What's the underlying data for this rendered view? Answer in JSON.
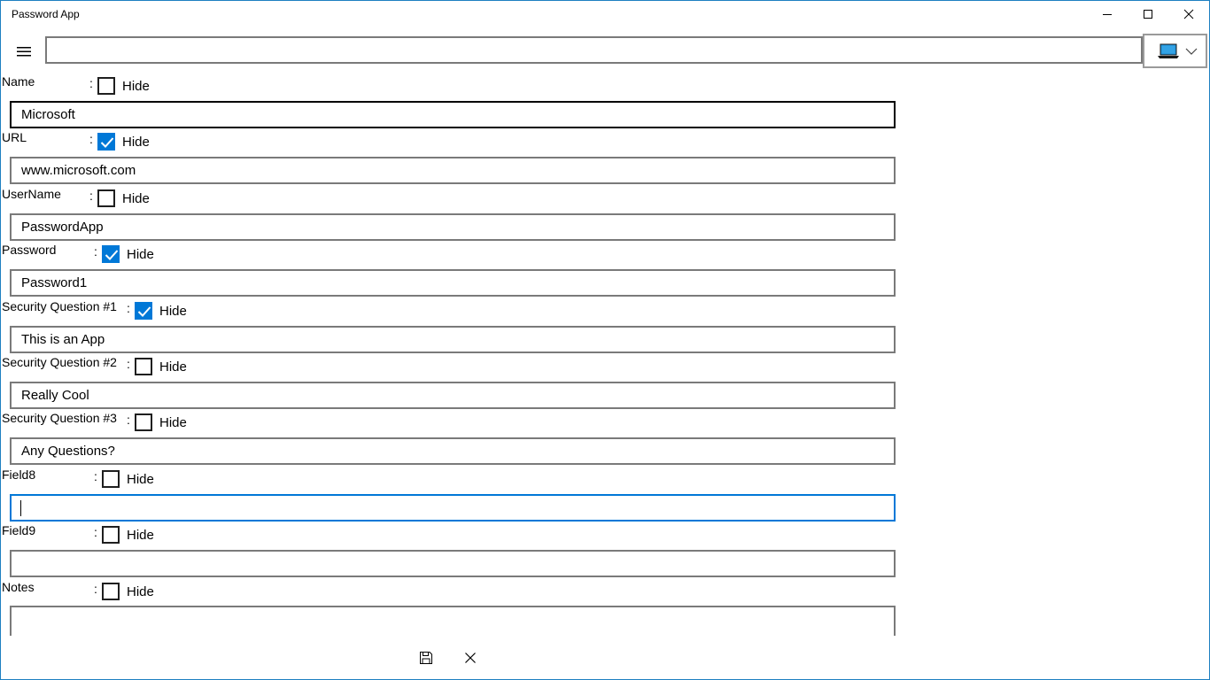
{
  "window": {
    "title": "Password App"
  },
  "toolbar": {
    "search_value": ""
  },
  "fields": [
    {
      "label": "Name",
      "hide_label": "Hide",
      "hidden": false,
      "value": "Microsoft"
    },
    {
      "label": "URL",
      "hide_label": "Hide",
      "hidden": true,
      "value": "www.microsoft.com"
    },
    {
      "label": "UserName",
      "hide_label": "Hide",
      "hidden": false,
      "value": "PasswordApp"
    },
    {
      "label": "Password",
      "hide_label": "Hide",
      "hidden": true,
      "value": "Password1"
    },
    {
      "label": "Security Question #1",
      "hide_label": "Hide",
      "hidden": true,
      "value": "This is an App"
    },
    {
      "label": "Security Question #2",
      "hide_label": "Hide",
      "hidden": false,
      "value": "Really Cool"
    },
    {
      "label": "Security Question #3",
      "hide_label": "Hide",
      "hidden": false,
      "value": "Any Questions?"
    },
    {
      "label": "Field8",
      "hide_label": "Hide",
      "hidden": false,
      "value": ""
    },
    {
      "label": "Field9",
      "hide_label": "Hide",
      "hidden": false,
      "value": ""
    },
    {
      "label": "Notes",
      "hide_label": "Hide",
      "hidden": false,
      "value": ""
    }
  ],
  "colon": ":",
  "icons": {
    "menu": "hamburger-menu-icon",
    "device": "laptop-icon",
    "dropdown": "chevron-down-icon",
    "save": "save-icon",
    "cancel": "close-icon"
  },
  "colors": {
    "accent": "#0078d7",
    "window_border": "#1e7fc1",
    "input_border": "#7a7a7a"
  }
}
